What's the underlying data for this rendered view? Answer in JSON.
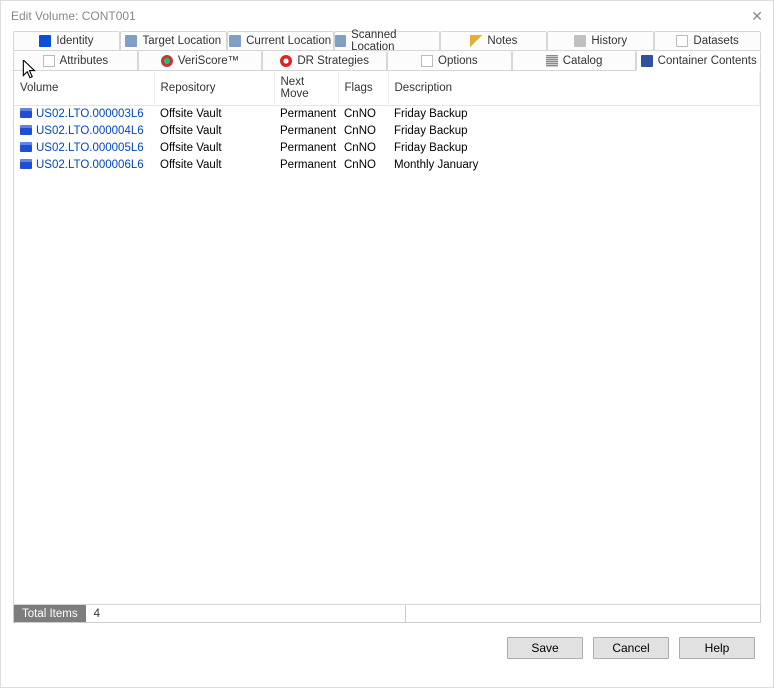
{
  "window": {
    "title": "Edit Volume: CONT001"
  },
  "tabs": {
    "row1": [
      {
        "label": "Identity",
        "icon": "ic-id"
      },
      {
        "label": "Target Location",
        "icon": "ic-loc"
      },
      {
        "label": "Current Location",
        "icon": "ic-loc"
      },
      {
        "label": "Scanned Location",
        "icon": "ic-loc"
      },
      {
        "label": "Notes",
        "icon": "ic-pen"
      },
      {
        "label": "History",
        "icon": "ic-hist"
      },
      {
        "label": "Datasets",
        "icon": "ic-ds"
      }
    ],
    "row2": [
      {
        "label": "Attributes",
        "icon": "ic-attr"
      },
      {
        "label": "VeriScore™",
        "icon": "ic-vscore"
      },
      {
        "label": "DR Strategies",
        "icon": "ic-dr"
      },
      {
        "label": "Options",
        "icon": "ic-opt"
      },
      {
        "label": "Catalog",
        "icon": "ic-cat"
      },
      {
        "label": "Container Contents",
        "icon": "ic-cont",
        "active": true
      }
    ]
  },
  "table": {
    "columns": [
      "Volume",
      "Repository",
      "Next Move",
      "Flags",
      "Description"
    ],
    "widths": [
      "140px",
      "120px",
      "64px",
      "50px",
      "auto"
    ],
    "rows": [
      {
        "volume": "US02.LTO.000003L6",
        "repository": "Offsite Vault",
        "nextmove": "Permanent",
        "flags": "CnNO",
        "description": "Friday Backup"
      },
      {
        "volume": "US02.LTO.000004L6",
        "repository": "Offsite Vault",
        "nextmove": "Permanent",
        "flags": "CnNO",
        "description": "Friday Backup"
      },
      {
        "volume": "US02.LTO.000005L6",
        "repository": "Offsite Vault",
        "nextmove": "Permanent",
        "flags": "CnNO",
        "description": "Friday Backup"
      },
      {
        "volume": "US02.LTO.000006L6",
        "repository": "Offsite Vault",
        "nextmove": "Permanent",
        "flags": "CnNO",
        "description": "Monthly January"
      }
    ]
  },
  "status": {
    "label": "Total Items",
    "value": "4"
  },
  "buttons": {
    "save": "Save",
    "cancel": "Cancel",
    "help": "Help"
  }
}
